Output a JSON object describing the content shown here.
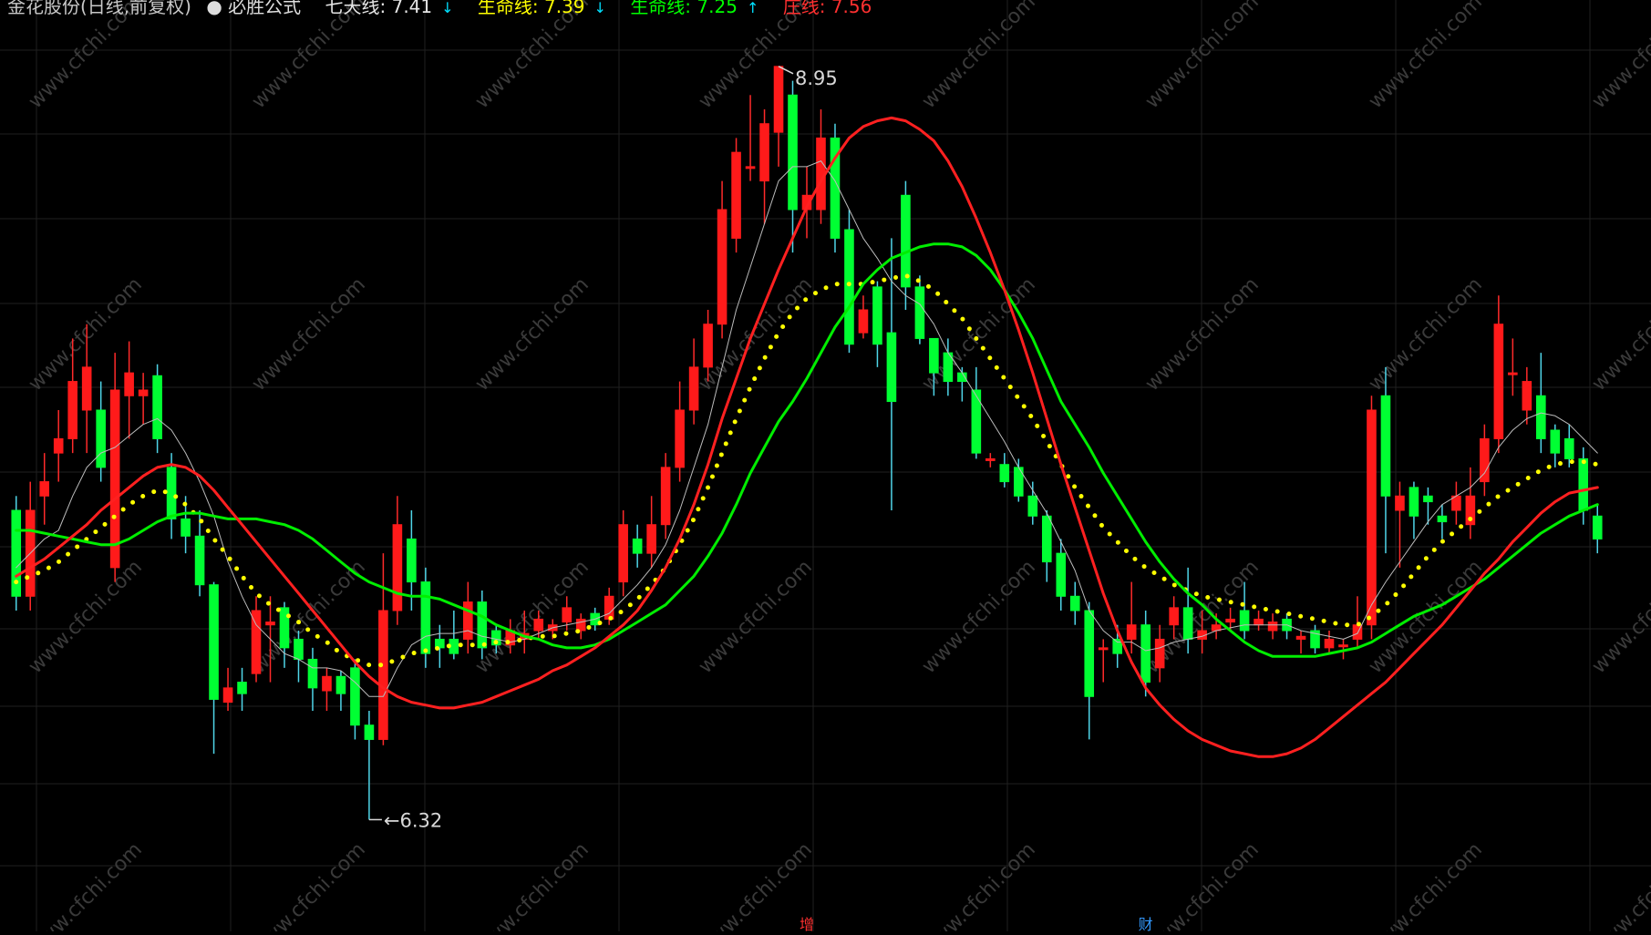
{
  "header": {
    "title": "金花股份(日线,前复权)",
    "indicator": "必胜公式",
    "items": [
      {
        "label": "七天线: 7.41",
        "color": "white",
        "arrow": "down"
      },
      {
        "label": "生命线: 7.39",
        "color": "yellow",
        "arrow": "down"
      },
      {
        "label": "生命线: 7.25",
        "color": "green",
        "arrow": "up"
      },
      {
        "label": "庄线: 7.56",
        "color": "red",
        "arrow": "none"
      }
    ]
  },
  "chart_data": {
    "type": "candlestick",
    "ylim": [
      6.0,
      9.15
    ],
    "high_label": "8.95",
    "low_label": "6.32",
    "high_value": 8.95,
    "low_value": 6.32,
    "colors": {
      "up": "#ff1a1a",
      "down": "#00ff33",
      "background": "#000000"
    },
    "watermark": "www.cfchi.com",
    "bottom_marks": [
      {
        "text": "增",
        "index": 56,
        "color": "red"
      },
      {
        "text": "财",
        "index": 80,
        "color": "blue"
      }
    ],
    "candles": [
      [
        7.4,
        7.1,
        7.45,
        7.05
      ],
      [
        7.1,
        7.4,
        7.5,
        7.05
      ],
      [
        7.45,
        7.5,
        7.6,
        7.35
      ],
      [
        7.6,
        7.65,
        7.75,
        7.5
      ],
      [
        7.65,
        7.85,
        8.0,
        7.6
      ],
      [
        7.75,
        7.9,
        8.05,
        7.6
      ],
      [
        7.75,
        7.55,
        7.85,
        7.5
      ],
      [
        7.2,
        7.82,
        7.95,
        7.15
      ],
      [
        7.8,
        7.88,
        7.99,
        7.65
      ],
      [
        7.8,
        7.82,
        7.88,
        7.7
      ],
      [
        7.87,
        7.65,
        7.91,
        7.6
      ],
      [
        7.55,
        7.37,
        7.6,
        7.3
      ],
      [
        7.37,
        7.31,
        7.45,
        7.25
      ],
      [
        7.31,
        7.14,
        7.4,
        7.1
      ],
      [
        7.14,
        6.74,
        7.15,
        6.55
      ],
      [
        6.73,
        6.78,
        6.85,
        6.7
      ],
      [
        6.8,
        6.76,
        6.85,
        6.7
      ],
      [
        6.83,
        7.05,
        7.1,
        6.8
      ],
      [
        7.0,
        7.01,
        7.1,
        6.8
      ],
      [
        7.06,
        6.92,
        7.08,
        6.85
      ],
      [
        6.95,
        6.88,
        6.98,
        6.8
      ],
      [
        6.88,
        6.78,
        6.92,
        6.7
      ],
      [
        6.77,
        6.82,
        6.85,
        6.7
      ],
      [
        6.82,
        6.76,
        6.84,
        6.7
      ],
      [
        6.85,
        6.65,
        6.88,
        6.6
      ],
      [
        6.65,
        6.6,
        6.7,
        6.32
      ],
      [
        6.6,
        7.05,
        7.25,
        6.58
      ],
      [
        7.05,
        7.35,
        7.45,
        7.0
      ],
      [
        7.3,
        7.15,
        7.4,
        7.05
      ],
      [
        7.15,
        6.9,
        7.2,
        6.85
      ],
      [
        6.95,
        6.92,
        7.0,
        6.85
      ],
      [
        6.95,
        6.9,
        7.05,
        6.88
      ],
      [
        6.95,
        7.08,
        7.15,
        6.9
      ],
      [
        7.08,
        6.92,
        7.12,
        6.88
      ],
      [
        6.98,
        6.93,
        7.0,
        6.9
      ],
      [
        6.93,
        6.98,
        7.02,
        6.9
      ],
      [
        6.95,
        6.97,
        7.05,
        6.9
      ],
      [
        6.98,
        7.02,
        7.05,
        6.95
      ],
      [
        6.98,
        7.0,
        7.02,
        6.95
      ],
      [
        7.01,
        7.06,
        7.1,
        6.98
      ],
      [
        6.98,
        7.02,
        7.04,
        6.95
      ],
      [
        7.04,
        7.0,
        7.06,
        6.98
      ],
      [
        7.02,
        7.1,
        7.13,
        7.0
      ],
      [
        7.15,
        7.35,
        7.4,
        7.1
      ],
      [
        7.3,
        7.25,
        7.35,
        7.2
      ],
      [
        7.25,
        7.35,
        7.45,
        7.2
      ],
      [
        7.35,
        7.55,
        7.6,
        7.3
      ],
      [
        7.55,
        7.75,
        7.85,
        7.5
      ],
      [
        7.75,
        7.9,
        8.0,
        7.7
      ],
      [
        7.9,
        8.05,
        8.1,
        7.85
      ],
      [
        8.05,
        8.45,
        8.55,
        8.0
      ],
      [
        8.35,
        8.65,
        8.7,
        8.3
      ],
      [
        8.6,
        8.6,
        8.85,
        8.55
      ],
      [
        8.55,
        8.75,
        8.8,
        8.4
      ],
      [
        8.72,
        8.95,
        8.95,
        8.6
      ],
      [
        8.85,
        8.45,
        8.9,
        8.3
      ],
      [
        8.45,
        8.5,
        8.6,
        8.35
      ],
      [
        8.45,
        8.7,
        8.8,
        8.4
      ],
      [
        8.7,
        8.35,
        8.75,
        8.3
      ],
      [
        8.38,
        7.98,
        8.45,
        7.95
      ],
      [
        8.02,
        8.1,
        8.15,
        8.0
      ],
      [
        8.18,
        7.98,
        8.2,
        7.9
      ],
      [
        8.02,
        7.78,
        8.35,
        7.4
      ],
      [
        8.5,
        8.18,
        8.55,
        8.1
      ],
      [
        8.18,
        8.0,
        8.22,
        7.98
      ],
      [
        8.0,
        7.88,
        8.0,
        7.8
      ],
      [
        7.95,
        7.85,
        8.0,
        7.8
      ],
      [
        7.88,
        7.85,
        7.9,
        7.78
      ],
      [
        7.82,
        7.6,
        7.9,
        7.58
      ],
      [
        7.58,
        7.58,
        7.6,
        7.55
      ],
      [
        7.56,
        7.5,
        7.6,
        7.48
      ],
      [
        7.55,
        7.45,
        7.58,
        7.43
      ],
      [
        7.45,
        7.38,
        7.5,
        7.35
      ],
      [
        7.38,
        7.22,
        7.4,
        7.15
      ],
      [
        7.25,
        7.1,
        7.3,
        7.05
      ],
      [
        7.1,
        7.05,
        7.15,
        7.0
      ],
      [
        7.05,
        6.75,
        7.08,
        6.6
      ],
      [
        6.92,
        6.92,
        6.95,
        6.8
      ],
      [
        6.95,
        6.9,
        7.0,
        6.85
      ],
      [
        6.95,
        7.0,
        7.15,
        6.9
      ],
      [
        7.0,
        6.8,
        7.05,
        6.75
      ],
      [
        6.85,
        6.95,
        7.0,
        6.8
      ],
      [
        7.0,
        7.06,
        7.1,
        6.95
      ],
      [
        7.06,
        6.95,
        7.2,
        6.9
      ],
      [
        6.95,
        6.98,
        7.05,
        6.9
      ],
      [
        6.98,
        7.0,
        7.04,
        6.95
      ],
      [
        7.01,
        7.02,
        7.06,
        6.98
      ],
      [
        7.05,
        6.98,
        7.15,
        6.95
      ],
      [
        7.0,
        7.02,
        7.05,
        6.98
      ],
      [
        6.98,
        7.01,
        7.04,
        6.95
      ],
      [
        7.02,
        6.98,
        7.04,
        6.95
      ],
      [
        6.95,
        6.96,
        6.98,
        6.9
      ],
      [
        6.98,
        6.92,
        7.0,
        6.9
      ],
      [
        6.92,
        6.95,
        6.98,
        6.9
      ],
      [
        6.93,
        6.93,
        6.95,
        6.88
      ],
      [
        6.95,
        7.0,
        7.1,
        6.92
      ],
      [
        7.0,
        7.75,
        7.8,
        6.95
      ],
      [
        7.8,
        7.45,
        7.9,
        7.25
      ],
      [
        7.4,
        7.45,
        7.5,
        7.2
      ],
      [
        7.48,
        7.38,
        7.5,
        7.3
      ],
      [
        7.45,
        7.43,
        7.48,
        7.35
      ],
      [
        7.38,
        7.36,
        7.42,
        7.3
      ],
      [
        7.4,
        7.45,
        7.5,
        7.35
      ],
      [
        7.35,
        7.45,
        7.55,
        7.3
      ],
      [
        7.5,
        7.65,
        7.7,
        7.45
      ],
      [
        7.65,
        8.05,
        8.15,
        7.6
      ],
      [
        7.88,
        7.88,
        8.0,
        7.8
      ],
      [
        7.75,
        7.85,
        7.9,
        7.7
      ],
      [
        7.8,
        7.65,
        7.95,
        7.6
      ],
      [
        7.68,
        7.6,
        7.7,
        7.55
      ],
      [
        7.65,
        7.58,
        7.7,
        7.55
      ],
      [
        7.58,
        7.4,
        7.62,
        7.35
      ],
      [
        7.38,
        7.3,
        7.42,
        7.25
      ]
    ],
    "series": [
      {
        "name": "七天线",
        "color": "#bbbbbb",
        "style": "solid",
        "width": 1,
        "values": [
          7.2,
          7.25,
          7.3,
          7.33,
          7.45,
          7.55,
          7.6,
          7.62,
          7.66,
          7.7,
          7.72,
          7.68,
          7.6,
          7.5,
          7.38,
          7.22,
          7.1,
          7.0,
          6.95,
          6.9,
          6.88,
          6.85,
          6.85,
          6.84,
          6.8,
          6.75,
          6.75,
          6.85,
          6.93,
          6.96,
          6.97,
          6.97,
          6.98,
          6.96,
          6.95,
          6.94,
          6.95,
          6.97,
          6.99,
          7.0,
          7.01,
          7.02,
          7.04,
          7.09,
          7.14,
          7.2,
          7.28,
          7.4,
          7.55,
          7.7,
          7.9,
          8.1,
          8.25,
          8.4,
          8.55,
          8.6,
          8.6,
          8.62,
          8.55,
          8.45,
          8.35,
          8.28,
          8.2,
          8.15,
          8.12,
          8.05,
          7.95,
          7.88,
          7.8,
          7.72,
          7.64,
          7.55,
          7.47,
          7.39,
          7.29,
          7.19,
          7.05,
          6.98,
          6.94,
          6.94,
          6.91,
          6.92,
          6.94,
          6.95,
          6.96,
          6.98,
          6.99,
          7.0,
          7.0,
          7.0,
          7.0,
          6.98,
          6.97,
          6.96,
          6.95,
          6.97,
          7.07,
          7.15,
          7.22,
          7.29,
          7.36,
          7.42,
          7.45,
          7.48,
          7.53,
          7.62,
          7.68,
          7.72,
          7.74,
          7.73,
          7.7,
          7.65,
          7.6
        ]
      },
      {
        "name": "生命线",
        "color": "#ffff00",
        "style": "dotted",
        "width": 5,
        "values": [
          7.15,
          7.17,
          7.19,
          7.22,
          7.26,
          7.3,
          7.34,
          7.38,
          7.42,
          7.45,
          7.47,
          7.46,
          7.42,
          7.37,
          7.3,
          7.24,
          7.17,
          7.11,
          7.07,
          7.04,
          7.01,
          6.97,
          6.94,
          6.9,
          6.88,
          6.86,
          6.86,
          6.88,
          6.9,
          6.91,
          6.92,
          6.93,
          6.93,
          6.93,
          6.94,
          6.94,
          6.95,
          6.96,
          6.96,
          6.97,
          6.98,
          7.0,
          7.02,
          7.05,
          7.09,
          7.14,
          7.2,
          7.28,
          7.37,
          7.48,
          7.6,
          7.72,
          7.83,
          7.93,
          8.02,
          8.09,
          8.14,
          8.17,
          8.19,
          8.19,
          8.19,
          8.2,
          8.21,
          8.22,
          8.2,
          8.17,
          8.12,
          8.07,
          8.0,
          7.93,
          7.86,
          7.79,
          7.72,
          7.64,
          7.56,
          7.48,
          7.41,
          7.34,
          7.29,
          7.24,
          7.2,
          7.17,
          7.14,
          7.12,
          7.1,
          7.09,
          7.08,
          7.07,
          7.06,
          7.05,
          7.04,
          7.03,
          7.02,
          7.01,
          7.0,
          7.0,
          7.03,
          7.07,
          7.12,
          7.18,
          7.24,
          7.29,
          7.33,
          7.37,
          7.41,
          7.45,
          7.48,
          7.51,
          7.54,
          7.56,
          7.57,
          7.57,
          7.56
        ]
      },
      {
        "name": "生命线",
        "color": "#00ee00",
        "style": "solid",
        "width": 3,
        "values": [
          7.33,
          7.33,
          7.32,
          7.31,
          7.3,
          7.29,
          7.28,
          7.28,
          7.3,
          7.33,
          7.36,
          7.38,
          7.39,
          7.39,
          7.38,
          7.37,
          7.37,
          7.37,
          7.36,
          7.35,
          7.33,
          7.3,
          7.26,
          7.22,
          7.18,
          7.15,
          7.13,
          7.11,
          7.1,
          7.1,
          7.09,
          7.07,
          7.05,
          7.03,
          7.0,
          6.98,
          6.96,
          6.95,
          6.93,
          6.92,
          6.92,
          6.93,
          6.95,
          6.98,
          7.01,
          7.04,
          7.07,
          7.12,
          7.17,
          7.24,
          7.32,
          7.42,
          7.53,
          7.62,
          7.71,
          7.78,
          7.86,
          7.95,
          8.04,
          8.11,
          8.19,
          8.24,
          8.28,
          8.3,
          8.32,
          8.33,
          8.33,
          8.32,
          8.29,
          8.24,
          8.17,
          8.09,
          8.0,
          7.89,
          7.78,
          7.7,
          7.62,
          7.53,
          7.45,
          7.37,
          7.29,
          7.22,
          7.16,
          7.11,
          7.07,
          7.02,
          6.98,
          6.94,
          6.91,
          6.89,
          6.89,
          6.89,
          6.89,
          6.9,
          6.91,
          6.92,
          6.94,
          6.97,
          7.0,
          7.03,
          7.05,
          7.07,
          7.1,
          7.13,
          7.16,
          7.2,
          7.24,
          7.28,
          7.32,
          7.35,
          7.38,
          7.4,
          7.42
        ]
      },
      {
        "name": "庄线",
        "color": "#ff2020",
        "style": "solid",
        "width": 3,
        "values": [
          7.17,
          7.2,
          7.23,
          7.27,
          7.31,
          7.35,
          7.4,
          7.44,
          7.48,
          7.52,
          7.55,
          7.56,
          7.55,
          7.52,
          7.47,
          7.41,
          7.35,
          7.29,
          7.23,
          7.17,
          7.11,
          7.05,
          6.99,
          6.93,
          6.87,
          6.82,
          6.78,
          6.75,
          6.73,
          6.72,
          6.71,
          6.71,
          6.72,
          6.73,
          6.75,
          6.77,
          6.79,
          6.81,
          6.84,
          6.86,
          6.89,
          6.92,
          6.96,
          7.0,
          7.05,
          7.12,
          7.2,
          7.3,
          7.42,
          7.56,
          7.72,
          7.86,
          8.0,
          8.12,
          8.24,
          8.35,
          8.46,
          8.55,
          8.63,
          8.7,
          8.74,
          8.76,
          8.77,
          8.76,
          8.73,
          8.69,
          8.62,
          8.53,
          8.42,
          8.3,
          8.17,
          8.03,
          7.88,
          7.72,
          7.56,
          7.41,
          7.26,
          7.11,
          6.98,
          6.87,
          6.78,
          6.72,
          6.67,
          6.63,
          6.6,
          6.58,
          6.56,
          6.55,
          6.54,
          6.54,
          6.55,
          6.57,
          6.6,
          6.64,
          6.68,
          6.72,
          6.76,
          6.8,
          6.85,
          6.9,
          6.95,
          7.0,
          7.06,
          7.12,
          7.18,
          7.23,
          7.29,
          7.34,
          7.39,
          7.43,
          7.46,
          7.47,
          7.48
        ]
      }
    ]
  }
}
